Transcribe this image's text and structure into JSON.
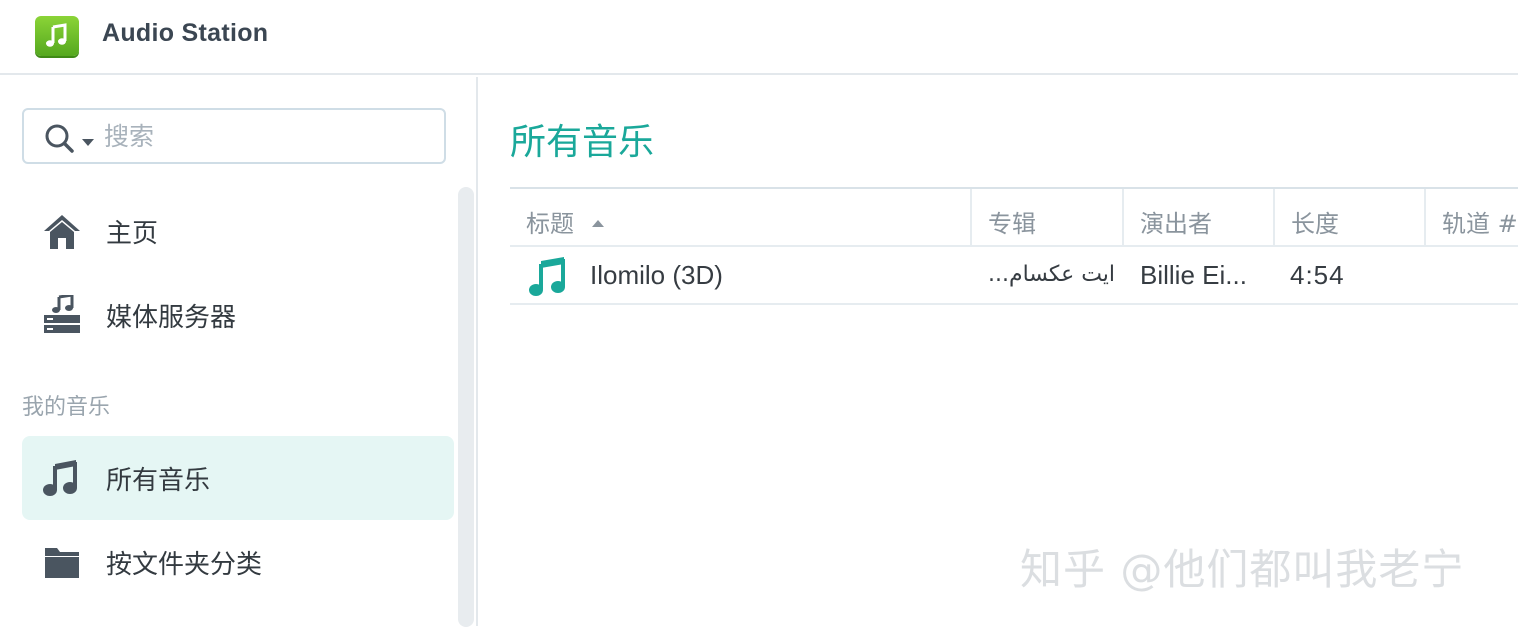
{
  "app": {
    "title": "Audio Station",
    "icon": "music-note-app-icon",
    "accent_color": "#1aa89a",
    "brand_color": "#6cc12a"
  },
  "sidebar": {
    "search": {
      "placeholder": "搜索",
      "value": ""
    },
    "items": [
      {
        "label": "主页",
        "icon": "home-icon",
        "active": false
      },
      {
        "label": "媒体服务器",
        "icon": "media-server-icon",
        "active": false
      }
    ],
    "section_label": "我的音乐",
    "music_items": [
      {
        "label": "所有音乐",
        "icon": "music-note-icon",
        "active": true
      },
      {
        "label": "按文件夹分类",
        "icon": "folder-icon",
        "active": false
      }
    ]
  },
  "main": {
    "title": "所有音乐",
    "table": {
      "columns": [
        {
          "label": "标题",
          "sorted": "ascending"
        },
        {
          "label": "专辑"
        },
        {
          "label": "演出者"
        },
        {
          "label": "长度"
        },
        {
          "label": "轨道 #"
        }
      ],
      "rows": [
        {
          "icon": "music-note-icon",
          "title": "Ilomilo (3D)",
          "album": "...ايت عكسام",
          "artist": "Billie Ei...",
          "length": "4:54",
          "track": ""
        }
      ]
    }
  },
  "watermark": "知乎 @他们都叫我老宁"
}
